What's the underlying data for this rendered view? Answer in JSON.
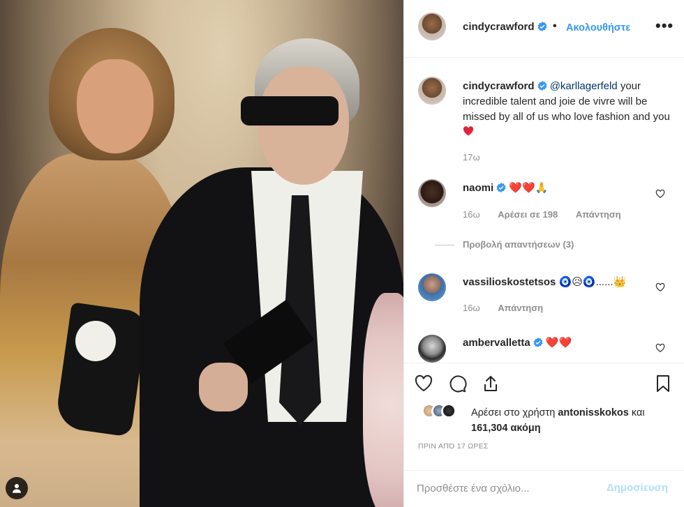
{
  "post": {
    "author": "cindycrawford",
    "follow_label": "Ακολουθήστε",
    "dot": "•",
    "more": "•••",
    "caption": {
      "username": "cindycrawford",
      "mention": "@karllagerfeld",
      "text": "your incredible talent and joie de vivre will be missed by all of us who love fashion and you",
      "time": "17ω"
    }
  },
  "comments": [
    {
      "username": "naomi",
      "emoji": "❤️❤️🙏",
      "time": "16ω",
      "likes": "Αρέσει σε 198",
      "reply": "Απάντηση",
      "view_replies": "Προβολή απαντήσεων (3)"
    },
    {
      "username": "vassilioskostetsos",
      "emoji": "🧿😥🧿......👑",
      "time": "16ω",
      "reply": "Απάντηση"
    },
    {
      "username": "ambervalletta",
      "emoji": "❤️❤️"
    }
  ],
  "likes": {
    "prefix": "Αρέσει στο χρήστη",
    "user": "antonisskokos",
    "conj": "και",
    "count": "161,304 ακόμη"
  },
  "timestamp": "ΠΡΙΝ ΑΠΌ 17 ΩΡΕΣ",
  "add_comment": {
    "placeholder": "Προσθέστε ένα σχόλιο...",
    "post_label": "Δημοσίευση"
  },
  "colors": {
    "accent": "#3897f0",
    "heart": "#ed4956",
    "muted": "#8e8e8e"
  }
}
